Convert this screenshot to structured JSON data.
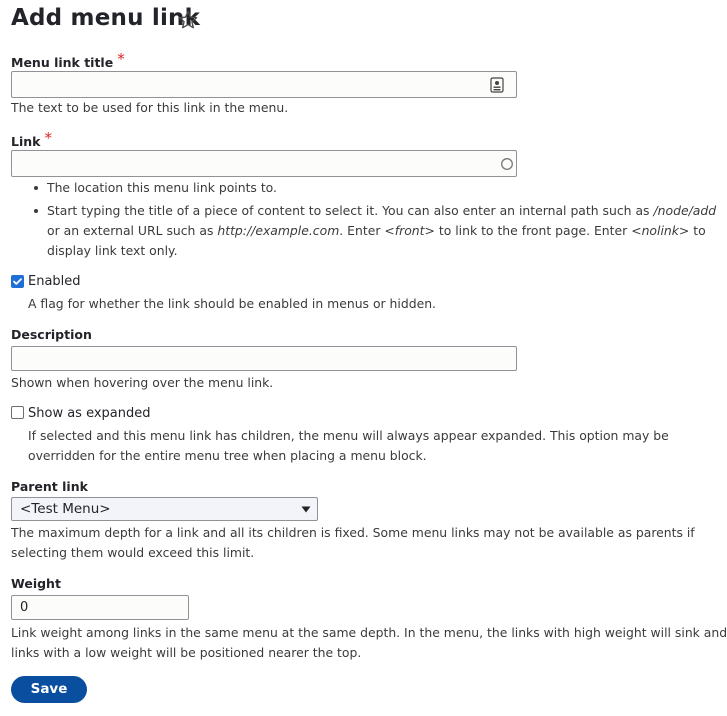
{
  "page": {
    "title": "Add menu link"
  },
  "fields": {
    "menu_link_title": {
      "label": "Menu link title",
      "required_marker": "*",
      "value": "",
      "description": "The text to be used for this link in the menu."
    },
    "link": {
      "label": "Link",
      "required_marker": "*",
      "value": "",
      "help_items": [
        "The location this menu link points to.",
        "Start typing the title of a piece of content to select it. You can also enter an internal path such as",
        "/node/add",
        "or an external URL such as",
        "http://example.com",
        ". Enter",
        "<front>",
        "to link to the front page. Enter",
        "<nolink>",
        "to",
        "display link text only."
      ]
    },
    "enabled": {
      "label": "Enabled",
      "checked": true,
      "description": "A flag for whether the link should be enabled in menus or hidden."
    },
    "description": {
      "label": "Description",
      "value": "",
      "description": "Shown when hovering over the menu link."
    },
    "expanded": {
      "label": "Show as expanded",
      "checked": false,
      "description_line1": "If selected and this menu link has children, the menu will always appear expanded. This option may be",
      "description_line2": "overridden for the entire menu tree when placing a menu block."
    },
    "parent_link": {
      "label": "Parent link",
      "selected": "<Test Menu>",
      "description_line1": "The maximum depth for a link and all its children is fixed. Some menu links may not be available as parents if",
      "description_line2": "selecting them would exceed this limit."
    },
    "weight": {
      "label": "Weight",
      "value": "0",
      "description_line1": "Link weight among links in the same menu at the same depth. In the menu, the links with high weight will sink and",
      "description_line2": "links with a low weight will be positioned nearer the top."
    }
  },
  "actions": {
    "save_label": "Save"
  },
  "icons": {
    "title_field_icon": "contact-card-icon",
    "link_field_icon": "autocomplete-circle-icon",
    "favorite_icon": "star-outline-icon",
    "select_arrow": "triangle-down-icon"
  },
  "colors": {
    "required": "#dc2323",
    "primary_button": "#0a4e9f",
    "checkbox_checked": "#1f6fd6"
  }
}
